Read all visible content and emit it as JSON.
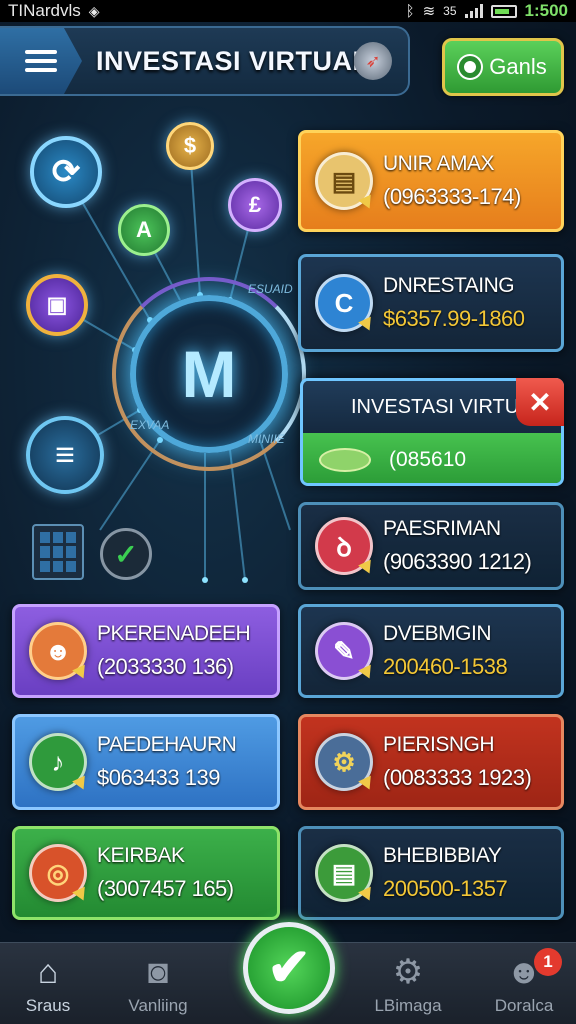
{
  "status_bar": {
    "carrier": "TINardvls",
    "time": "1:500",
    "network_label": "35",
    "icons": [
      "bluetooth-icon",
      "wifi-icon",
      "signal-icon",
      "battery-icon"
    ]
  },
  "header": {
    "title": "INVESTASI VIRTUAL",
    "menu_icon": "hamburger-menu-icon",
    "decor_icon": "rocket-icon"
  },
  "goals_button": {
    "label": "Ganls",
    "icon": "target-icon"
  },
  "hub": {
    "letter": "M",
    "labels": [
      "ESUAID",
      "EXVAA",
      "MINIIE"
    ]
  },
  "nodes": [
    {
      "icon": "dollar-coin-icon",
      "glyph": "$",
      "color": "#c88a2e"
    },
    {
      "icon": "refresh-icon",
      "glyph": "⟳",
      "color": "#1f7fb8"
    },
    {
      "icon": "compass-icon",
      "glyph": "A",
      "color": "#2c9a3c"
    },
    {
      "icon": "dollar-person-icon",
      "glyph": "£",
      "color": "#7b3fbf"
    },
    {
      "icon": "box-icon",
      "glyph": "▣",
      "color": "#6a3ec0"
    },
    {
      "icon": "list-icon",
      "glyph": "≡",
      "color": "#1c5f8e"
    }
  ],
  "cards": [
    {
      "id": "unir-amax",
      "name": "UNIR AMAX",
      "value": "(0963333-174)",
      "icon": "document-icon",
      "glyph": "▤",
      "icon_color": "#e4b64a",
      "style": "c-orange",
      "gold": false
    },
    {
      "id": "dnresting",
      "name": "DNRESTAING",
      "value": "$6357.99-1860",
      "icon": "refresh-coin-icon",
      "glyph": "C",
      "icon_color": "#2e84d3",
      "style": "c-dark",
      "gold": true
    },
    {
      "id": "paesriman",
      "name": "PAESRIMAN",
      "value": "(9063390 1212)",
      "icon": "flame-icon",
      "glyph": "ꝺ",
      "icon_color": "#d23a4b",
      "style": "c-darkgreen",
      "gold": false
    },
    {
      "id": "pkerenadeeh",
      "name": "PKERENADEEH",
      "value": "(2033330 136)",
      "icon": "mascot-icon",
      "glyph": "☻",
      "icon_color": "#e47a3a",
      "style": "c-purple",
      "gold": false
    },
    {
      "id": "dvebmgin",
      "name": "DVEBMGIN",
      "value": "200460-1538",
      "icon": "magic-wand-icon",
      "glyph": "✎",
      "icon_color": "#8a4fd3",
      "style": "c-dark",
      "gold": true
    },
    {
      "id": "paedehaurn",
      "name": "PAEDEHAURN",
      "value": "$063433 139",
      "icon": "music-note-icon",
      "glyph": "♪",
      "icon_color": "#2f9a3c",
      "style": "c-blue",
      "gold": false
    },
    {
      "id": "pierisngh",
      "name": "PIERISNGH",
      "value": "(0083333 1923)",
      "icon": "gear-skull-icon",
      "glyph": "⚙",
      "icon_color": "#4a6d98",
      "style": "c-red",
      "gold": false
    },
    {
      "id": "keirbak",
      "name": "KEIRBAK",
      "value": "(3007457 165)",
      "icon": "coin-scroll-icon",
      "glyph": "◎",
      "icon_color": "#d8522a",
      "style": "c-green",
      "gold": false
    },
    {
      "id": "bhebibbiay",
      "name": "BHEBIBBIAY",
      "value": "200500-1357",
      "icon": "notes-icon",
      "glyph": "▤",
      "icon_color": "#3c9b3a",
      "style": "c-darkgreen",
      "gold": true
    }
  ],
  "virtual_popup": {
    "title": "INVESTASI VIRTUAL",
    "value": "(085610",
    "close_icon": "close-icon",
    "close_glyph": "✕"
  },
  "bottom_nav": {
    "items": [
      {
        "label": "Sraus",
        "icon": "home-icon",
        "glyph": "⌂",
        "active": true
      },
      {
        "label": "Vanliing",
        "icon": "camera-icon",
        "glyph": "◙",
        "active": false
      },
      {
        "label": "LBimaga",
        "icon": "settings-icon",
        "glyph": "⚙",
        "active": false
      },
      {
        "label": "Doralca",
        "icon": "profile-icon",
        "glyph": "☻",
        "active": false
      }
    ],
    "center_icon": "checkmark-icon",
    "center_glyph": "✔",
    "badge_count": "1"
  }
}
